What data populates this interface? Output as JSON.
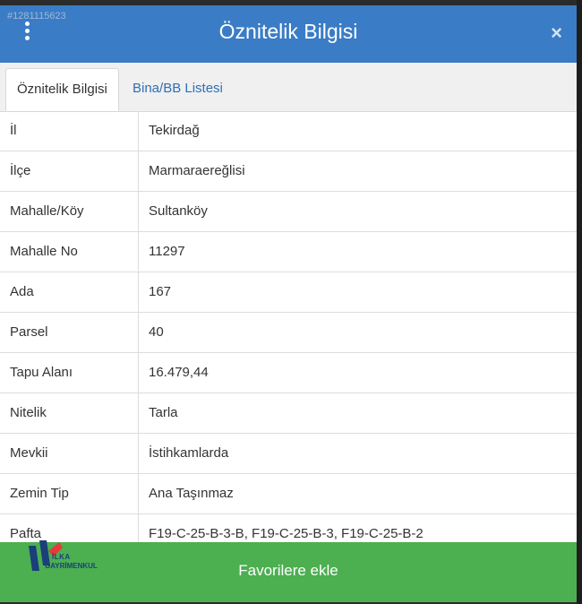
{
  "header": {
    "title": "Öznitelik Bilgisi",
    "watermark": "#1281115623",
    "close": "×"
  },
  "tabs": [
    {
      "label": "Öznitelik Bilgisi",
      "active": true
    },
    {
      "label": "Bina/BB Listesi",
      "active": false
    }
  ],
  "rows": [
    {
      "key": "İl",
      "value": "Tekirdağ"
    },
    {
      "key": "İlçe",
      "value": "Marmaraereğlisi"
    },
    {
      "key": "Mahalle/Köy",
      "value": "Sultanköy"
    },
    {
      "key": "Mahalle No",
      "value": "11297"
    },
    {
      "key": "Ada",
      "value": "167"
    },
    {
      "key": "Parsel",
      "value": "40"
    },
    {
      "key": "Tapu Alanı",
      "value": "16.479,44"
    },
    {
      "key": "Nitelik",
      "value": "Tarla"
    },
    {
      "key": "Mevkii",
      "value": "İstihkamlarda"
    },
    {
      "key": "Zemin Tip",
      "value": "Ana Taşınmaz"
    },
    {
      "key": "Pafta",
      "value": "F19-C-25-B-3-B, F19-C-25-B-3, F19-C-25-B-2"
    }
  ],
  "footer": {
    "button_label": "Favorilere ekle",
    "logo_line1": "İLKA",
    "logo_line2": "GAYRİMENKUL"
  },
  "colors": {
    "header": "#3a7cc6",
    "button": "#4caf50",
    "tab_link": "#2f6fb5"
  }
}
